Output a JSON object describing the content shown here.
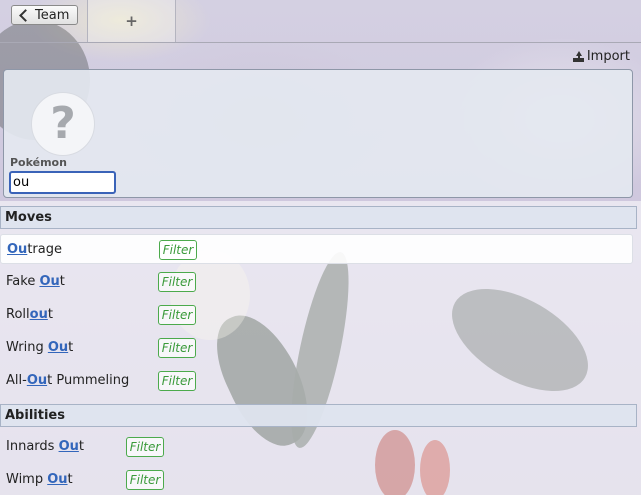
{
  "tabs": {
    "team_label": "Team",
    "add_label": "+"
  },
  "import_label": "Import",
  "pokemon": {
    "label": "Pokémon",
    "value": "ou",
    "placeholder": "?"
  },
  "moves": {
    "heading": "Moves",
    "filter_label": "Filter",
    "items": [
      {
        "pre": "",
        "match": "Ou",
        "post": "trage"
      },
      {
        "pre": "Fake ",
        "match": "Ou",
        "post": "t"
      },
      {
        "pre": "Roll",
        "match": "ou",
        "post": "t"
      },
      {
        "pre": "Wring ",
        "match": "Ou",
        "post": "t"
      },
      {
        "pre": "All-",
        "match": "Ou",
        "post": "t Pummeling"
      }
    ]
  },
  "abilities": {
    "heading": "Abilities",
    "filter_label": "Filter",
    "items": [
      {
        "pre": "Innards ",
        "match": "Ou",
        "post": "t"
      },
      {
        "pre": "Wimp ",
        "match": "Ou",
        "post": "t"
      }
    ]
  }
}
